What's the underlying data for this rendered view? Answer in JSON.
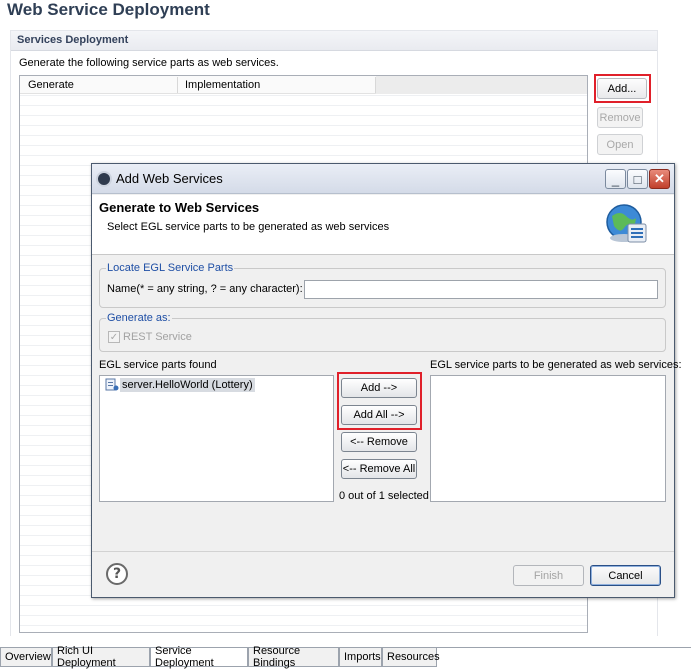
{
  "editor": {
    "page_title": "Web Service Deployment",
    "section_title": "Services Deployment",
    "section_desc": "Generate the following service parts as web services.",
    "table_headers": [
      "Generate",
      "Implementation"
    ],
    "buttons": {
      "add": "Add...",
      "remove": "Remove",
      "open": "Open"
    }
  },
  "dialog": {
    "title": "Add Web Services",
    "heading": "Generate to Web Services",
    "subheading": "Select EGL service parts to be generated as web services",
    "locate_group": "Locate EGL Service Parts",
    "name_label": "Name(* = any string, ? = any character):",
    "name_value": "",
    "generate_as_group": "Generate as:",
    "rest_label": "REST Service",
    "rest_checked": true,
    "found_label": "EGL service parts found",
    "found_items": [
      "server.HelloWorld (Lottery)"
    ],
    "target_label": "EGL service parts to be generated as web services:",
    "add_btn": "Add -->",
    "add_all_btn": "Add All -->",
    "remove_btn": "<-- Remove",
    "remove_all_btn": "<-- Remove All",
    "selection_count": "0 out of 1 selected",
    "finish_btn": "Finish",
    "cancel_btn": "Cancel",
    "minimize_glyph": "_",
    "maximize_glyph": "□",
    "close_glyph": "✕",
    "help_glyph": "?",
    "check_glyph": "✓"
  },
  "tabs": [
    "Overview",
    "Rich UI Deployment",
    "Service Deployment",
    "Resource Bindings",
    "Imports",
    "Resources"
  ],
  "active_tab": "Service Deployment",
  "colors": {
    "highlight_box": "#e0202a",
    "title": "#2f3f55",
    "group_label": "#1f4fa5"
  }
}
